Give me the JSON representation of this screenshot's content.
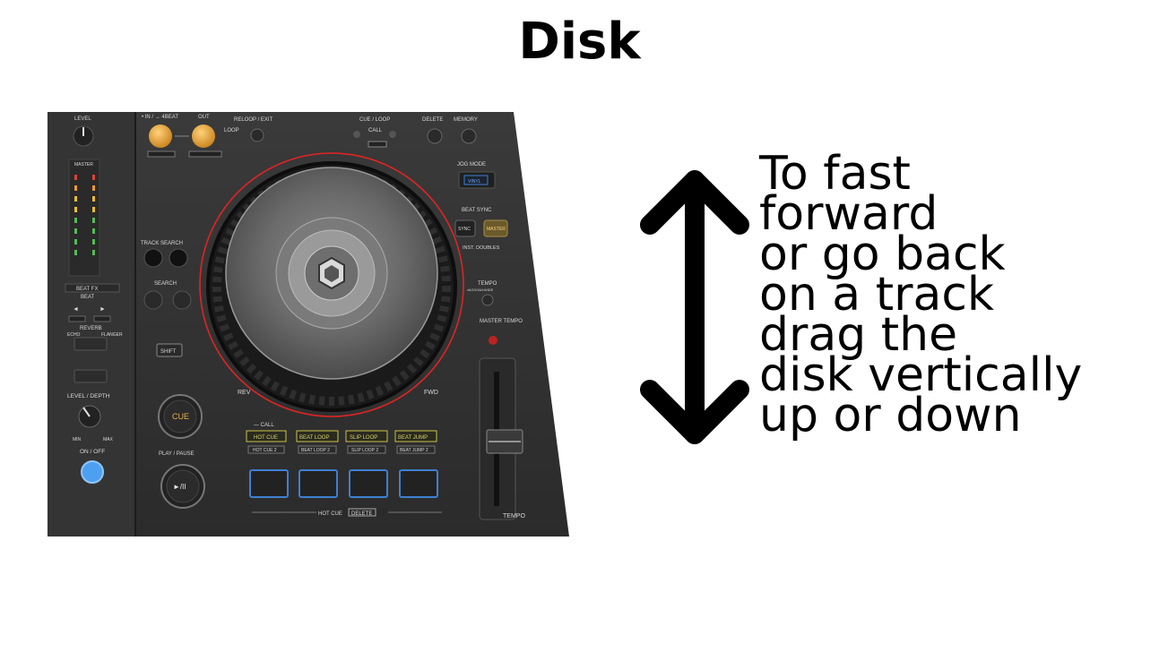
{
  "title": "Disk",
  "instructions": {
    "lines": [
      "To fast",
      "forward",
      "or go back",
      "on a track",
      "drag the",
      "disk vertically",
      "up or down"
    ]
  },
  "controller": {
    "level": "LEVEL",
    "in_4beat": "• IN / → 4BEAT",
    "out": "OUT",
    "reloop_exit": "RELOOP / EXIT",
    "loop": "LOOP",
    "cue_loop": "CUE / LOOP",
    "call": "CALL",
    "delete": "DELETE",
    "memory": "MEMORY",
    "jog_mode": "JOG MODE",
    "vinyl": "VINYL",
    "beat_sync": "BEAT SYNC",
    "sync": "SYNC",
    "master": "MASTER",
    "inst_doubles": "INST. DOUBLES",
    "tempo_section": "TEMPO",
    "tempo_range": "±6/10/16/±WIDE",
    "master_tempo": "MASTER TEMPO",
    "track_search": "TRACK SEARCH",
    "search": "SEARCH",
    "beat_fx": "BEAT FX",
    "beat": "BEAT",
    "reverb": "REVERB",
    "echo": "ECHO",
    "flanger": "FLANGER",
    "level_depth": "LEVEL / DEPTH",
    "min": "MIN",
    "max": "MAX",
    "on_off": "ON / OFF",
    "shift": "SHIFT",
    "cue": "CUE",
    "play_pause": "PLAY / PAUSE",
    "play_symbol": "►/II",
    "rev": "REV",
    "fwd": "FWD",
    "call_small": "— CALL",
    "hot_cue": "HOT CUE",
    "beat_loop": "BEAT LOOP",
    "slip_loop": "SLIP LOOP",
    "beat_jump": "BEAT JUMP",
    "hot_cue_2": "HOT CUE 2",
    "beat_loop_2": "BEAT LOOP 2",
    "slip_loop_2": "SLIP LOOP 2",
    "beat_jump_2": "BEAT JUMP 2",
    "hot_cue_delete": "HOT CUE",
    "delete_box": "DELETE",
    "tempo": "TEMPO"
  },
  "colors": {
    "jog_ring": "#e02424",
    "arrow": "#000000",
    "pad_blue": "#3f7fd0",
    "on_off_blue": "#4d9ff0",
    "pad_mode_yellow": "#c9c34a"
  }
}
